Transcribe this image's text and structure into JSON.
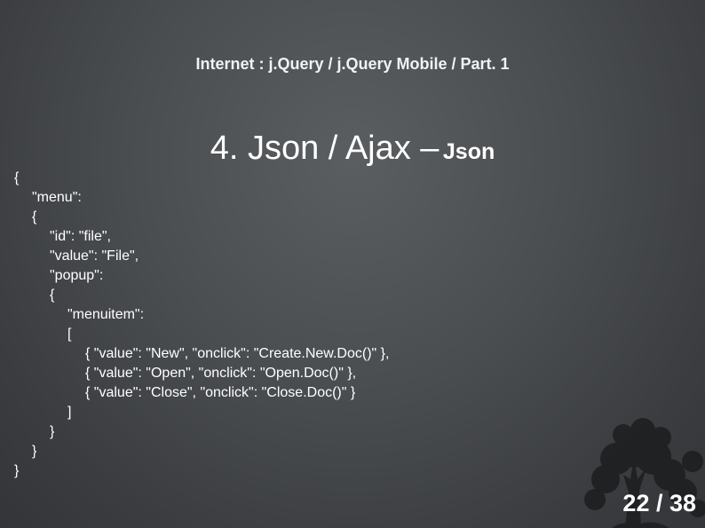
{
  "slide": {
    "header": "Internet : j.Query / j.Query Mobile / Part. 1",
    "title_main": "4. Json / Ajax –",
    "title_sub": "Json",
    "page_number": "22 / 38"
  },
  "code_lines": [
    {
      "indent": 0,
      "text": "{"
    },
    {
      "indent": 1,
      "text": "\"menu\":"
    },
    {
      "indent": 1,
      "text": "{"
    },
    {
      "indent": 2,
      "text": "\"id\": \"file\","
    },
    {
      "indent": 2,
      "text": "\"value\": \"File\","
    },
    {
      "indent": 2,
      "text": "\"popup\":"
    },
    {
      "indent": 2,
      "text": "{"
    },
    {
      "indent": 3,
      "text": "\"menuitem\":"
    },
    {
      "indent": 3,
      "text": "["
    },
    {
      "indent": 4,
      "text": "{ \"value\": \"New\", \"onclick\": \"Create.New.Doc()\" },"
    },
    {
      "indent": 4,
      "text": "{ \"value\": \"Open\", \"onclick\": \"Open.Doc()\" },"
    },
    {
      "indent": 4,
      "text": "{ \"value\": \"Close\", \"onclick\": \"Close.Doc()\" }"
    },
    {
      "indent": 3,
      "text": "]"
    },
    {
      "indent": 2,
      "text": "}"
    },
    {
      "indent": 1,
      "text": "}"
    },
    {
      "indent": 0,
      "text": "}"
    }
  ],
  "decoration": {
    "icon": "tree-silhouette-icon"
  }
}
